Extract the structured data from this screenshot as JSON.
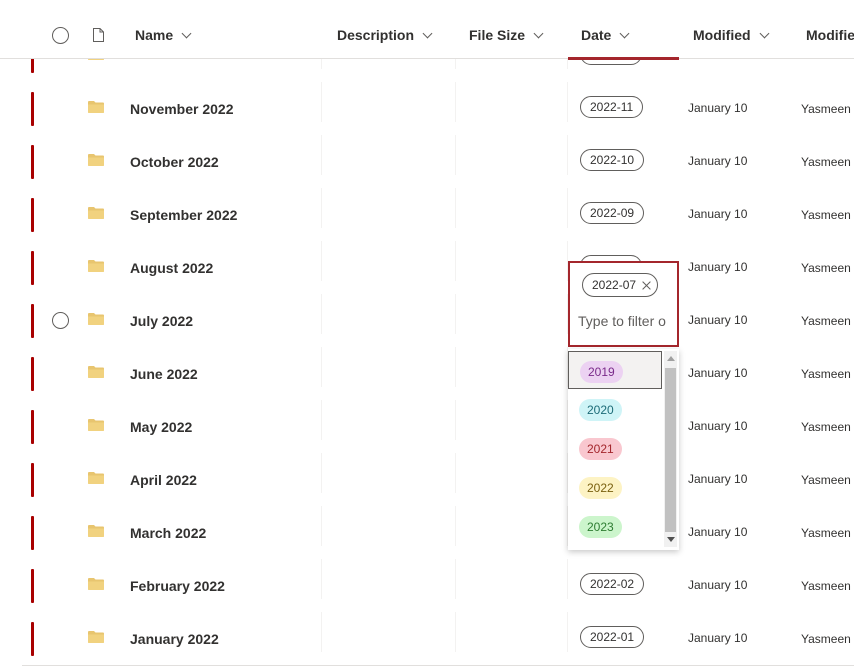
{
  "columns": {
    "name": "Name",
    "description": "Description",
    "file_size": "File Size",
    "date": "Date",
    "modified": "Modified",
    "modified_by": "Modifie"
  },
  "rows": [
    {
      "name": "",
      "date": "",
      "modified": "",
      "modified_by": ""
    },
    {
      "name": "November 2022",
      "date": "2022-11",
      "modified": "January 10",
      "modified_by": "Yasmeen K"
    },
    {
      "name": "October 2022",
      "date": "2022-10",
      "modified": "January 10",
      "modified_by": "Yasmeen K"
    },
    {
      "name": "September 2022",
      "date": "2022-09",
      "modified": "January 10",
      "modified_by": "Yasmeen K"
    },
    {
      "name": "August 2022",
      "date": "",
      "modified": "January 10",
      "modified_by": "Yasmeen K"
    },
    {
      "name": "July 2022",
      "date": "",
      "modified": "January 10",
      "modified_by": "Yasmeen K"
    },
    {
      "name": "June 2022",
      "date": "",
      "modified": "January 10",
      "modified_by": "Yasmeen K"
    },
    {
      "name": "May 2022",
      "date": "",
      "modified": "January 10",
      "modified_by": "Yasmeen K"
    },
    {
      "name": "April 2022",
      "date": "",
      "modified": "January 10",
      "modified_by": "Yasmeen K"
    },
    {
      "name": "March 2022",
      "date": "",
      "modified": "January 10",
      "modified_by": "Yasmeen K"
    },
    {
      "name": "February 2022",
      "date": "2022-02",
      "modified": "January 10",
      "modified_by": "Yasmeen K"
    },
    {
      "name": "January 2022",
      "date": "2022-01",
      "modified": "January 10",
      "modified_by": "Yasmeen K"
    }
  ],
  "filter": {
    "selected_tag": "2022-07",
    "placeholder": "Type to filter o",
    "options": [
      {
        "label": "2019",
        "bg": "#ecd2f2",
        "fg": "#7a2a8a"
      },
      {
        "label": "2020",
        "bg": "#cff4f7",
        "fg": "#1d6c78"
      },
      {
        "label": "2021",
        "bg": "#f9c7cf",
        "fg": "#a4262c"
      },
      {
        "label": "2022",
        "bg": "#fdf3c4",
        "fg": "#7a6110"
      },
      {
        "label": "2023",
        "bg": "#ccf5cc",
        "fg": "#2e7d32"
      }
    ]
  },
  "colors": {
    "accent": "#a4262c",
    "row_marker": "#a80000",
    "folder": "#e8c56f"
  }
}
